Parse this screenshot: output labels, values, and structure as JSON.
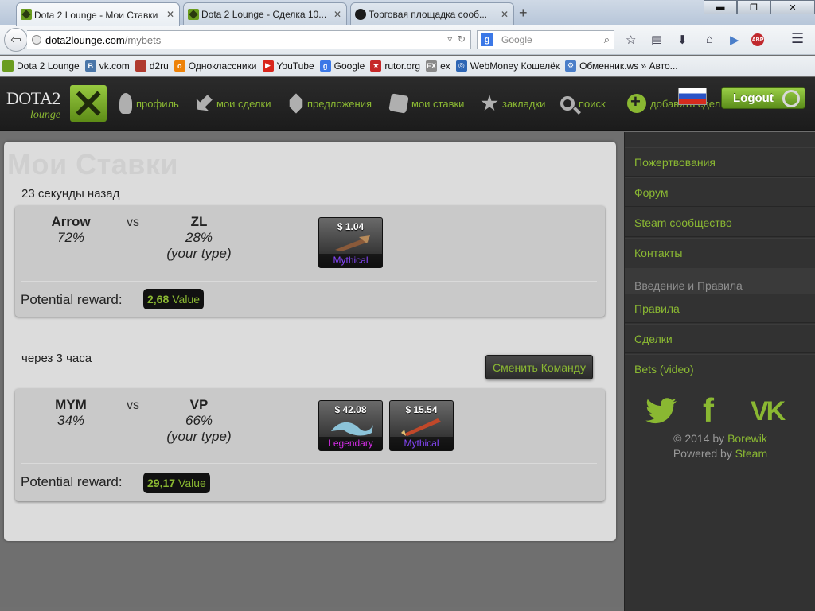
{
  "browser": {
    "tabs": [
      {
        "title": "Dota 2 Lounge - Мои Ставки",
        "active": true,
        "icon": "dota-favicon"
      },
      {
        "title": "Dota 2 Lounge - Сделка 10...",
        "active": false,
        "icon": "dota-favicon"
      },
      {
        "title": "Торговая площадка сооб...",
        "active": false,
        "icon": "steam-favicon"
      }
    ],
    "new_tab": "+",
    "window_controls": {
      "minimize": "▬",
      "maximize": "❐",
      "close": "✕"
    },
    "url_host": "dota2lounge.com",
    "url_path": "/mybets",
    "search_engine": "Google",
    "search_placeholder": "Google",
    "bookmarks": [
      {
        "label": "Dota 2 Lounge",
        "color": "#6a9c1f",
        "glyph": ""
      },
      {
        "label": "vk.com",
        "color": "#4a76a8",
        "glyph": "B"
      },
      {
        "label": "d2ru",
        "color": "#b03a2e",
        "glyph": ""
      },
      {
        "label": "Одноклассники",
        "color": "#ee8208",
        "glyph": "o"
      },
      {
        "label": "YouTube",
        "color": "#d9261c",
        "glyph": "▶"
      },
      {
        "label": "Google",
        "color": "#3b78e7",
        "glyph": "g"
      },
      {
        "label": "rutor.org",
        "color": "#c62828",
        "glyph": "★"
      },
      {
        "label": "ex",
        "color": "#8a8a8a",
        "glyph": "EX"
      },
      {
        "label": "WebMoney Кошелёк",
        "color": "#2e66b5",
        "glyph": "◎"
      },
      {
        "label": "Обменник.ws » Авто...",
        "color": "#4a7ec9",
        "glyph": "⚙"
      }
    ]
  },
  "site": {
    "logo_word": "DOTA2",
    "logo_sub": "lounge",
    "menu": [
      {
        "label": "профиль",
        "icon": "person-icon"
      },
      {
        "label": "мои сделки",
        "icon": "trade-arrows-icon"
      },
      {
        "label": "предложения",
        "icon": "tag-icon"
      },
      {
        "label": "мои ставки",
        "icon": "dice-icon"
      },
      {
        "label": "закладки",
        "icon": "star-icon"
      },
      {
        "label": "поиск",
        "icon": "search-icon"
      },
      {
        "label": "добавить сдел",
        "icon": "add-icon"
      }
    ],
    "logout_label": "Logout"
  },
  "main": {
    "title": "Мои Ставки",
    "bets": [
      {
        "time": "23 секунды назад",
        "team1": {
          "name": "Arrow",
          "pct": "72%"
        },
        "vs": "vs",
        "team2": {
          "name": "ZL",
          "pct": "28%",
          "note": "(your type)"
        },
        "items": [
          {
            "price": "$ 1.04",
            "rarity": "Mythical",
            "rarity_color": "#8847ff"
          }
        ],
        "reward_label": "Potential reward:",
        "reward_amount": "2,68",
        "reward_unit": "Value"
      },
      {
        "time": "через 3 часа",
        "team1": {
          "name": "MYM",
          "pct": "34%"
        },
        "vs": "vs",
        "team2": {
          "name": "VP",
          "pct": "66%",
          "note": "(your type)"
        },
        "items": [
          {
            "price": "$ 42.08",
            "rarity": "Legendary",
            "rarity_color": "#d32ce6"
          },
          {
            "price": "$ 15.54",
            "rarity": "Mythical",
            "rarity_color": "#8847ff"
          }
        ],
        "reward_label": "Potential reward:",
        "reward_amount": "29,17",
        "reward_unit": "Value",
        "switch_label": "Сменить Команду"
      }
    ]
  },
  "sidebar": {
    "links_top": [
      "Пожертвования",
      "Форум",
      "Steam сообщество",
      "Контакты"
    ],
    "heading": "Введение и Правила",
    "links_bottom": [
      "Правила",
      "Сделки",
      "Bets (video)"
    ],
    "footer_line1_pre": "© 2014 by",
    "footer_line1_name": "Borewik",
    "footer_line2_pre": "Powered by",
    "footer_line2_name": "Steam"
  },
  "colors": {
    "accent_green": "#8ab832",
    "mythical": "#8847ff",
    "legendary": "#d32ce6"
  }
}
